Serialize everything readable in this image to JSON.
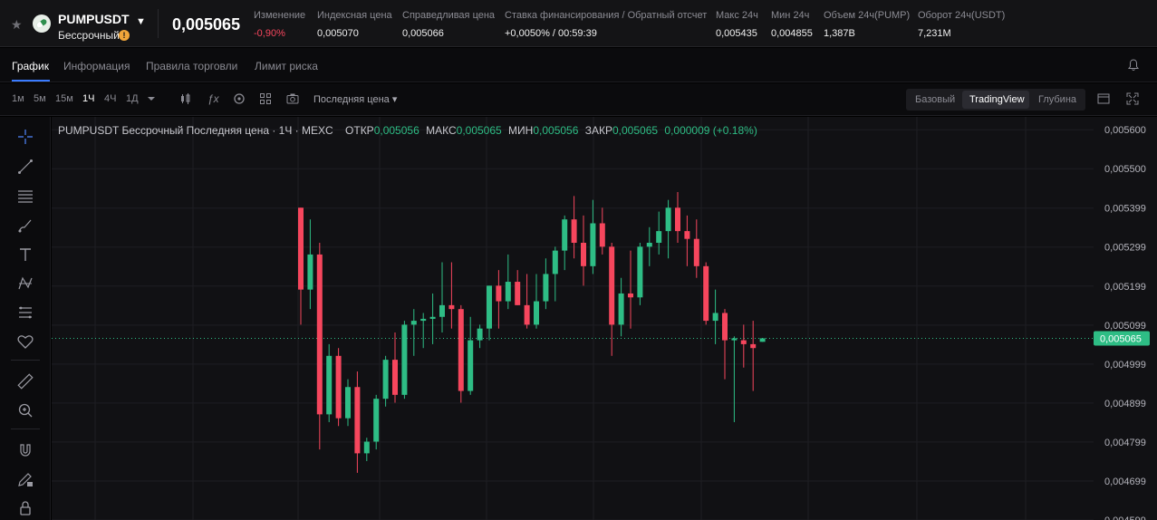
{
  "ticker": {
    "symbol": "PUMPUSDT",
    "subtitle": "Бессрочный",
    "info_badge": "!",
    "last_price": "0,005065",
    "stats": [
      {
        "label": "Изменение",
        "value": "-0,90%",
        "negative": true
      },
      {
        "label": "Индексная цена",
        "value": "0,005070"
      },
      {
        "label": "Справедливая цена",
        "value": "0,005066"
      },
      {
        "label": "Ставка финансирования / Обратный отсчет",
        "value": "+0,0050% / 00:59:39"
      },
      {
        "label": "Макс 24ч",
        "value": "0,005435"
      },
      {
        "label": "Мин 24ч",
        "value": "0,004855"
      },
      {
        "label": "Объем 24ч(PUMP)",
        "value": "1,387B"
      },
      {
        "label": "Оборот 24ч(USDT)",
        "value": "7,231M"
      }
    ]
  },
  "tabs": [
    "График",
    "Информация",
    "Правила торговли",
    "Лимит риска"
  ],
  "toolbar": {
    "timeframes": [
      "1м",
      "5м",
      "15м",
      "1Ч",
      "4Ч",
      "1Д"
    ],
    "active_timeframe": "1Ч",
    "price_type": "Последняя цена ▾",
    "views": [
      "Базовый",
      "TradingView",
      "Глубина"
    ],
    "active_view": "TradingView"
  },
  "tools": [
    "crosshair-icon",
    "trend-line-icon",
    "horizontal-lines-icon",
    "brush-icon",
    "text-icon",
    "pattern-icon",
    "fib-icon",
    "heart-icon",
    "ruler-icon",
    "zoom-in-icon",
    "magnet-icon",
    "pencil-lock-icon",
    "lock-icon"
  ],
  "legend": {
    "title": "PUMPUSDT Бессрочный Последняя цена · 1Ч · MEXC",
    "open_label": "ОТКР",
    "open": "0,005056",
    "high_label": "МАКС",
    "high": "0,005065",
    "low_label": "МИН",
    "low": "0,005056",
    "close_label": "ЗАКР",
    "close": "0,005065",
    "change": "0,000009 (+0.18%)"
  },
  "colors": {
    "up": "#2ebd85",
    "down": "#f6465d",
    "accent": "#3a7bff"
  },
  "chart_data": {
    "type": "candlestick",
    "y_ticks": [
      "0,005600",
      "0,005500",
      "0,005399",
      "0,005299",
      "0,005199",
      "0,005099",
      "0,004999",
      "0,004899",
      "0,004799",
      "0,004699",
      "0,004599"
    ],
    "ylim": [
      0.004599,
      0.005633
    ],
    "current_price": 0.005065,
    "current_price_label": "0,005065",
    "candles": [
      {
        "o": 0.0054,
        "h": 0.0054,
        "l": 0.0051,
        "c": 0.00519
      },
      {
        "o": 0.00519,
        "h": 0.00537,
        "l": 0.00514,
        "c": 0.00528
      },
      {
        "o": 0.00528,
        "h": 0.00531,
        "l": 0.00478,
        "c": 0.00487
      },
      {
        "o": 0.00487,
        "h": 0.00505,
        "l": 0.00485,
        "c": 0.00502
      },
      {
        "o": 0.00502,
        "h": 0.00504,
        "l": 0.00484,
        "c": 0.00486
      },
      {
        "o": 0.00486,
        "h": 0.00496,
        "l": 0.00484,
        "c": 0.00494
      },
      {
        "o": 0.00494,
        "h": 0.00498,
        "l": 0.00472,
        "c": 0.00477
      },
      {
        "o": 0.00477,
        "h": 0.00481,
        "l": 0.00475,
        "c": 0.0048
      },
      {
        "o": 0.0048,
        "h": 0.00492,
        "l": 0.00478,
        "c": 0.00491
      },
      {
        "o": 0.00491,
        "h": 0.00502,
        "l": 0.00489,
        "c": 0.00501
      },
      {
        "o": 0.00501,
        "h": 0.00508,
        "l": 0.0049,
        "c": 0.00492
      },
      {
        "o": 0.00492,
        "h": 0.00511,
        "l": 0.00491,
        "c": 0.0051
      },
      {
        "o": 0.0051,
        "h": 0.00514,
        "l": 0.00502,
        "c": 0.00511
      },
      {
        "o": 0.00511,
        "h": 0.00513,
        "l": 0.00504,
        "c": 0.005115
      },
      {
        "o": 0.005115,
        "h": 0.00518,
        "l": 0.00505,
        "c": 0.00512
      },
      {
        "o": 0.00512,
        "h": 0.00526,
        "l": 0.00508,
        "c": 0.00515
      },
      {
        "o": 0.00515,
        "h": 0.00526,
        "l": 0.00509,
        "c": 0.00514
      },
      {
        "o": 0.00514,
        "h": 0.00515,
        "l": 0.0049,
        "c": 0.00493
      },
      {
        "o": 0.00493,
        "h": 0.00512,
        "l": 0.00492,
        "c": 0.00506
      },
      {
        "o": 0.00506,
        "h": 0.0051,
        "l": 0.00504,
        "c": 0.00509
      },
      {
        "o": 0.00509,
        "h": 0.0052,
        "l": 0.00506,
        "c": 0.0052
      },
      {
        "o": 0.0052,
        "h": 0.00524,
        "l": 0.00509,
        "c": 0.00516
      },
      {
        "o": 0.00516,
        "h": 0.00528,
        "l": 0.00514,
        "c": 0.00521
      },
      {
        "o": 0.00521,
        "h": 0.00524,
        "l": 0.00515,
        "c": 0.00515
      },
      {
        "o": 0.00515,
        "h": 0.00523,
        "l": 0.00509,
        "c": 0.0051
      },
      {
        "o": 0.0051,
        "h": 0.00523,
        "l": 0.00509,
        "c": 0.00516
      },
      {
        "o": 0.00516,
        "h": 0.00527,
        "l": 0.00514,
        "c": 0.00523
      },
      {
        "o": 0.00523,
        "h": 0.0053,
        "l": 0.00516,
        "c": 0.00529
      },
      {
        "o": 0.00529,
        "h": 0.00538,
        "l": 0.00524,
        "c": 0.00537
      },
      {
        "o": 0.00537,
        "h": 0.00543,
        "l": 0.00527,
        "c": 0.00531
      },
      {
        "o": 0.00531,
        "h": 0.00538,
        "l": 0.0052,
        "c": 0.00525
      },
      {
        "o": 0.00525,
        "h": 0.00542,
        "l": 0.00523,
        "c": 0.00536
      },
      {
        "o": 0.00536,
        "h": 0.0054,
        "l": 0.00528,
        "c": 0.0053
      },
      {
        "o": 0.0053,
        "h": 0.00531,
        "l": 0.00502,
        "c": 0.0051
      },
      {
        "o": 0.0051,
        "h": 0.00522,
        "l": 0.00507,
        "c": 0.00518
      },
      {
        "o": 0.00518,
        "h": 0.00529,
        "l": 0.00509,
        "c": 0.00517
      },
      {
        "o": 0.00517,
        "h": 0.00531,
        "l": 0.00515,
        "c": 0.0053
      },
      {
        "o": 0.0053,
        "h": 0.00535,
        "l": 0.00525,
        "c": 0.00531
      },
      {
        "o": 0.00531,
        "h": 0.00539,
        "l": 0.00528,
        "c": 0.00534
      },
      {
        "o": 0.00534,
        "h": 0.00542,
        "l": 0.00527,
        "c": 0.0054
      },
      {
        "o": 0.0054,
        "h": 0.00544,
        "l": 0.00531,
        "c": 0.00534
      },
      {
        "o": 0.00534,
        "h": 0.00538,
        "l": 0.00525,
        "c": 0.00532
      },
      {
        "o": 0.00532,
        "h": 0.00537,
        "l": 0.00522,
        "c": 0.00525
      },
      {
        "o": 0.00525,
        "h": 0.00526,
        "l": 0.0051,
        "c": 0.00511
      },
      {
        "o": 0.00511,
        "h": 0.00519,
        "l": 0.00505,
        "c": 0.00513
      },
      {
        "o": 0.00513,
        "h": 0.00514,
        "l": 0.00496,
        "c": 0.00506
      },
      {
        "o": 0.00506,
        "h": 0.00507,
        "l": 0.00485,
        "c": 0.005065
      },
      {
        "o": 0.00506,
        "h": 0.0051,
        "l": 0.00499,
        "c": 0.00505
      },
      {
        "o": 0.00505,
        "h": 0.00511,
        "l": 0.00493,
        "c": 0.00504
      },
      {
        "o": 0.005056,
        "h": 0.005065,
        "l": 0.005056,
        "c": 0.005065
      }
    ]
  }
}
